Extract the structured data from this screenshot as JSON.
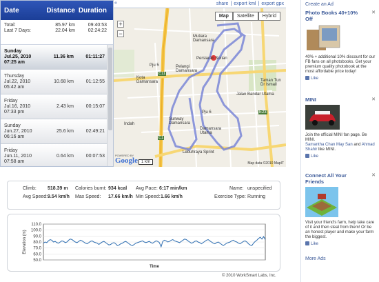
{
  "workouts": {
    "headers": {
      "date": "Date",
      "distance": "Distance",
      "duration": "Duration"
    },
    "totals": [
      {
        "label": "Total:",
        "distance": "85.97 km",
        "duration": "09:40:53"
      },
      {
        "label": "Last 7 Days:",
        "distance": "22.04 km",
        "duration": "02:24:22"
      }
    ],
    "rows": [
      {
        "day": "Sunday",
        "date": "Jul.25, 2010",
        "time": "07:25 am",
        "distance": "11.36 km",
        "duration": "01:11:27",
        "selected": true
      },
      {
        "day": "Thursday",
        "date": "Jul.22, 2010",
        "time": "05:42 am",
        "distance": "10.68 km",
        "duration": "01:12:55",
        "selected": false
      },
      {
        "day": "Friday",
        "date": "Jul.16, 2010",
        "time": "07:33 pm",
        "distance": "2.43 km",
        "duration": "00:15:07",
        "selected": false
      },
      {
        "day": "Sunday",
        "date": "Jun.27, 2010",
        "time": "06:16 am",
        "distance": "25.6 km",
        "duration": "02:49:21",
        "selected": false
      },
      {
        "day": "Friday",
        "date": "Jun.11, 2010",
        "time": "07:58 am",
        "distance": "0.64 km",
        "duration": "00:07:53",
        "selected": false
      }
    ]
  },
  "map": {
    "links": {
      "share": "share",
      "sep1": "|",
      "export_kml": "export kml",
      "sep2": "|",
      "export_gpx": "export gpx"
    },
    "collapse_arrow": "«",
    "types": {
      "map": "Map",
      "satellite": "Satellite",
      "hybrid": "Hybrid"
    },
    "zoom_in": "+",
    "zoom_out": "−",
    "labels": {
      "mutiara": "Mutiara Damansara",
      "pju5": "Pju 5",
      "pelangi": "Pelangi Damansara",
      "uptown": "Damansara Utama",
      "sunway": "Sunway Damansara",
      "taman_tun": "Taman Tun Dr Ismail",
      "damansara_pju6": "Pju 6",
      "persiaran_surian": "Persiaran Surian",
      "lebuhraya": "Lebuhraya Sprint",
      "e11": "E11",
      "e1": "E1",
      "e23": "E23",
      "kota": "Kota Damansara",
      "indah": "Indah",
      "jln": "Jalan Bandar Utama"
    },
    "powered_by": "POWERED BY",
    "logo": "Google",
    "scale": "1 km",
    "attribution": "Map data ©2010 MapIT",
    "route_color": "#7a86d6"
  },
  "stats": {
    "climb_label": "Climb:",
    "climb": "518.39 m",
    "calories_label": "Calories burnt:",
    "calories": "934 kcal",
    "avg_pace_label": "Avg Pace:",
    "avg_pace": "6:17 min/km",
    "name_label": "Name:",
    "name": "unspecified",
    "avg_speed_label": "Avg Speed:",
    "avg_speed": "9.54 km/h",
    "max_speed_label": "Max Speed:",
    "max_speed": "17.66 km/h",
    "min_speed_label": "Min Speed:",
    "min_speed": "1.66 km/h",
    "exercise_type_label": "Exercise Type:",
    "exercise_type": "Running"
  },
  "chart_data": {
    "type": "line",
    "title": "",
    "xlabel": "Time",
    "ylabel": "Elevation (m)",
    "ylim": [
      50,
      110
    ],
    "yticks": [
      "110.0",
      "100.0",
      "90.0",
      "80.0",
      "70.0",
      "60.0",
      "50.0"
    ],
    "grid": true,
    "color": "#2b6cb0",
    "values": [
      78,
      80,
      79,
      82,
      84,
      83,
      80,
      81,
      79,
      78,
      80,
      82,
      81,
      79,
      80,
      83,
      85,
      84,
      82,
      80,
      79,
      81,
      83,
      82,
      80,
      78,
      77,
      79,
      81,
      82,
      80,
      79,
      78,
      76,
      78,
      80,
      81,
      79,
      77,
      75,
      76,
      78,
      79,
      77,
      74,
      75,
      77,
      78,
      80,
      81,
      79,
      77,
      75,
      74,
      76,
      78,
      79,
      80,
      81,
      82,
      80,
      79,
      80,
      81,
      79,
      78,
      80,
      82,
      81,
      79,
      72,
      81,
      83,
      82,
      80,
      81,
      83,
      84,
      82,
      81,
      80,
      79,
      81,
      83,
      85,
      84,
      82,
      80,
      78,
      79,
      81,
      82,
      80,
      79,
      77,
      79,
      81,
      83,
      84,
      82,
      80,
      78,
      77,
      79,
      80,
      78,
      76,
      74,
      76,
      78,
      79,
      80,
      82,
      83,
      81,
      80,
      78,
      77,
      79,
      81,
      82,
      80,
      77,
      75,
      74,
      78,
      81,
      83,
      86,
      88,
      85,
      89,
      84
    ]
  },
  "copyright": "© 2010 WorkSmart Labs, Inc.",
  "ads": {
    "create_ad": "Create an Ad",
    "more_ads": "More Ads",
    "close": "✕",
    "like": "Like",
    "photo_books": {
      "title": "Photo Books 40+10% Off",
      "body": "40% + additional 10% discount for our FB fans on all photobooks. Get your premium quality photobook at the most affordable price today!"
    },
    "mini": {
      "title": "MINI",
      "body": "Join the official MINI fan page. Be MINI.",
      "friends": "Samantha Chan May San",
      "and": "and",
      "friend2": "Ahmad Shahir",
      "likes": "like MINI."
    },
    "friends": {
      "title": "Connect All Your Friends",
      "body": "Visit your friend's farm, help take care of it and then steal from them! Or be an honest player and make your farm the biggest."
    }
  }
}
